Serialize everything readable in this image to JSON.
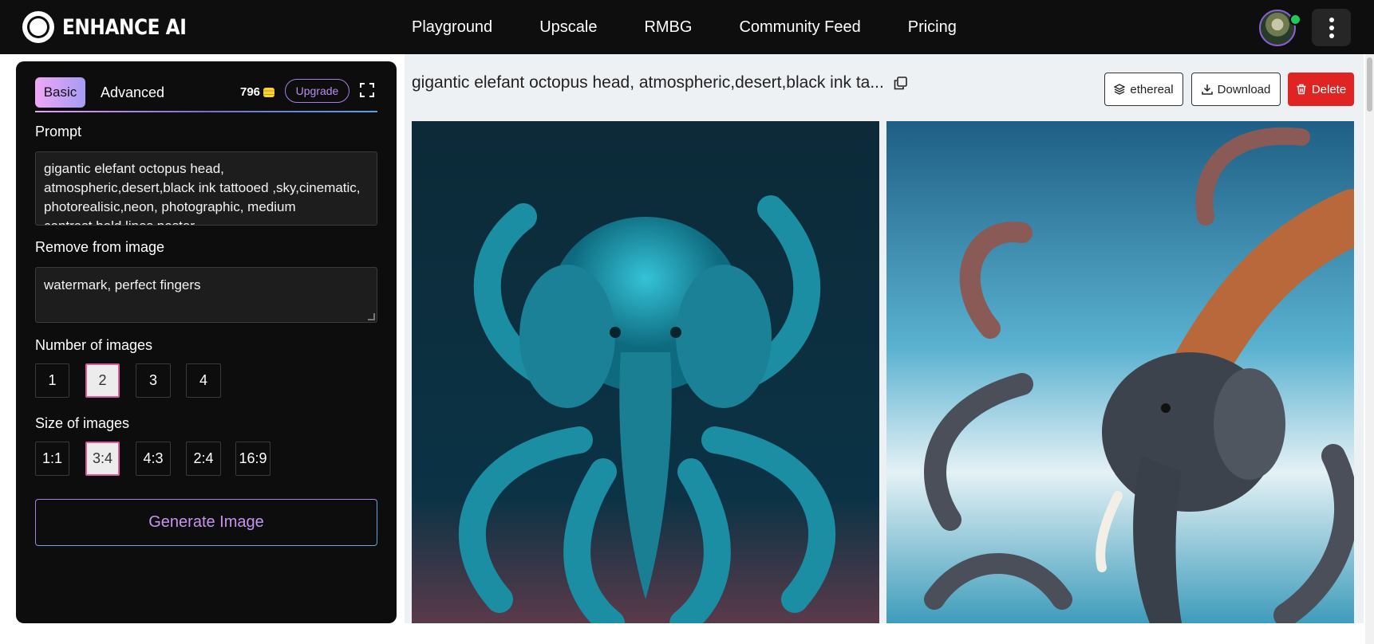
{
  "app": {
    "name": "ENHANCE AI"
  },
  "nav": [
    "Playground",
    "Upscale",
    "RMBG",
    "Community Feed",
    "Pricing"
  ],
  "panel": {
    "tabs": {
      "basic": "Basic",
      "advanced": "Advanced"
    },
    "credits": "796",
    "upgrade_label": "Upgrade",
    "prompt_label": "Prompt",
    "prompt_value": "gigantic elefant octopus head, atmospheric,desert,black ink tattooed ,sky,cinematic, photorealisic,neon, photographic, medium contrast,bold lines,poster",
    "remove_label": "Remove from image",
    "remove_value": "watermark, perfect fingers",
    "num_label": "Number of images",
    "num_options": [
      "1",
      "2",
      "3",
      "4"
    ],
    "num_selected": "2",
    "size_label": "Size of images",
    "size_options": [
      "1:1",
      "3:4",
      "4:3",
      "2:4",
      "16:9"
    ],
    "size_selected": "3:4",
    "generate_label": "Generate Image"
  },
  "main": {
    "title": "gigantic elefant octopus head, atmospheric,desert,black ink ta...",
    "style_label": "ethereal",
    "download_label": "Download",
    "delete_label": "Delete"
  },
  "colors": {
    "accent": "#a57ee6",
    "delete": "#e02424",
    "online": "#22c55e"
  },
  "icons": [
    "logo-icon",
    "coin-icon",
    "expand-icon",
    "copy-icon",
    "layers-icon",
    "download-icon",
    "trash-icon",
    "kebab-menu-icon"
  ]
}
